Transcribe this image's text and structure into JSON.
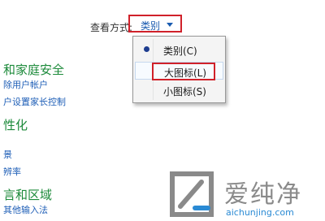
{
  "viewby": {
    "label": "查看方式:",
    "selected": "类别"
  },
  "sections": [
    {
      "title": "和家庭安全",
      "links": [
        "除用户帐户",
        "户设置家长控制"
      ]
    },
    {
      "title": "性化",
      "links": [
        "景",
        "辨率"
      ]
    },
    {
      "title": "言和区域",
      "links": [
        "其他输入法"
      ]
    }
  ],
  "menu": {
    "items": [
      {
        "label": "类别(C)",
        "checked": true
      },
      {
        "label": "大图标(L)",
        "checked": false
      },
      {
        "label": "小图标(S)",
        "checked": false
      }
    ]
  },
  "watermark": {
    "title": "爱纯净",
    "url": "aichunjing.com"
  },
  "colors": {
    "section_title": "#1c8a3a",
    "link": "#1f5fb7",
    "highlight": "#d0212a"
  }
}
